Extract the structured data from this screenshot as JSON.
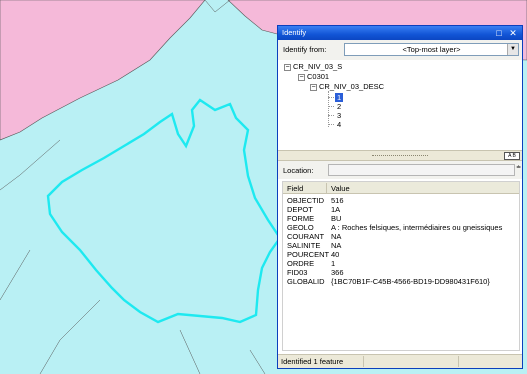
{
  "window": {
    "title": "Identify",
    "minimize_glyph": "□",
    "close_glyph": "✕"
  },
  "identify_from": {
    "label": "Identify from:",
    "value": "<Top-most layer>"
  },
  "tree": {
    "root": "CR_NIV_03_S",
    "child": "C0301",
    "layer": "CR_NIV_03_DESC",
    "items": [
      "1",
      "2",
      "3",
      "4"
    ],
    "selected_index": 0
  },
  "location": {
    "label": "Location:",
    "value": ""
  },
  "ab_button_label": "A B",
  "table": {
    "columns": [
      "Field",
      "Value"
    ],
    "rows": [
      {
        "field": "OBJECTID",
        "value": "516"
      },
      {
        "field": "DEPOT",
        "value": "1A"
      },
      {
        "field": "FORME",
        "value": "BU"
      },
      {
        "field": "GEOLO",
        "value": "A : Roches felsiques, intermédiaires ou gneissiques"
      },
      {
        "field": "COURANT",
        "value": "NA"
      },
      {
        "field": "SALINITE",
        "value": "NA"
      },
      {
        "field": "POURCENT",
        "value": "40"
      },
      {
        "field": "ORDRE",
        "value": "1"
      },
      {
        "field": "FID03",
        "value": "366"
      },
      {
        "field": "GLOBALID",
        "value": "{1BC70B1F-C45B-4566-BD19-DD980431F610}"
      }
    ]
  },
  "status": {
    "text": "Identified 1 feature"
  },
  "colors": {
    "map_water": "#b9f0f4",
    "map_pink": "#f5b9d9",
    "highlight": "#1ee9f0",
    "titlebar": "#1255d6"
  }
}
